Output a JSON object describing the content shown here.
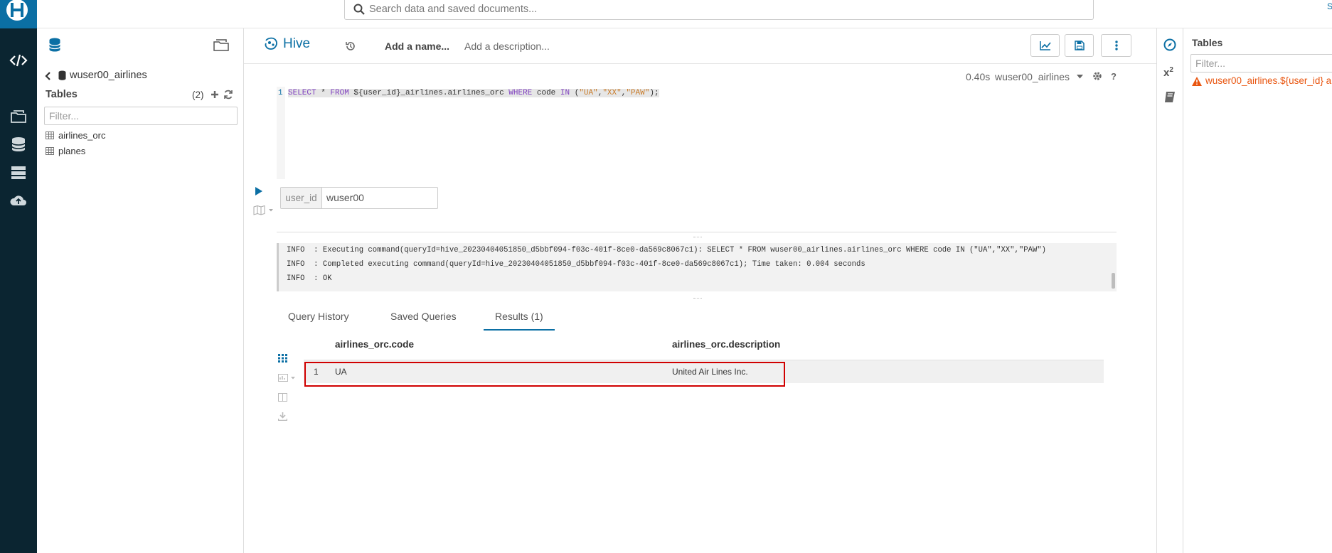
{
  "search": {
    "placeholder": "Search data and saved documents..."
  },
  "assist": {
    "database": "wuser00_airlines",
    "tables_label": "Tables",
    "tables_count": "(2)",
    "filter_placeholder": "Filter...",
    "tables": [
      "airlines_orc",
      "planes"
    ]
  },
  "editor": {
    "engine": "Hive",
    "name_placeholder": "Add a name...",
    "description_placeholder": "Add a description...",
    "timing": "0.40s",
    "database": "wuser00_airlines",
    "line_number": "1",
    "query": {
      "kw_select": "SELECT",
      "star": " * ",
      "kw_from": "FROM",
      "table": " ${user_id}_airlines.airlines_orc ",
      "kw_where": "WHERE",
      "col": " code ",
      "kw_in": "IN",
      "open": " (",
      "v1": "\"UA\"",
      "c1": ",",
      "v2": "\"XX\"",
      "c2": ",",
      "v3": "\"PAW\"",
      "close": ");"
    },
    "param_name": "user_id",
    "param_value": "wuser00"
  },
  "log": {
    "lines": [
      "INFO  : Executing command(queryId=hive_20230404051850_d5bbf094-f03c-401f-8ce0-da569c8067c1): SELECT * FROM wuser00_airlines.airlines_orc WHERE code IN (\"UA\",\"XX\",\"PAW\")",
      "INFO  : Completed executing command(queryId=hive_20230404051850_d5bbf094-f03c-401f-8ce0-da569c8067c1); Time taken: 0.004 seconds",
      "INFO  : OK"
    ]
  },
  "tabs": [
    "Query History",
    "Saved Queries",
    "Results (1)"
  ],
  "results": {
    "columns": [
      "airlines_orc.code",
      "airlines_orc.description"
    ],
    "rows": [
      {
        "n": "1",
        "code": "UA",
        "description": "United Air Lines Inc."
      }
    ]
  },
  "right_panel": {
    "title": "Tables",
    "filter_placeholder": "Filter...",
    "warning": "wuser00_airlines.${user_id} a"
  },
  "colors": {
    "rail": "#0b2531",
    "accent": "#0b6fa4",
    "keyword": "#7f3fbf",
    "string": "#c97c2a",
    "warning": "#e9550f",
    "highlight": "#d00000"
  }
}
